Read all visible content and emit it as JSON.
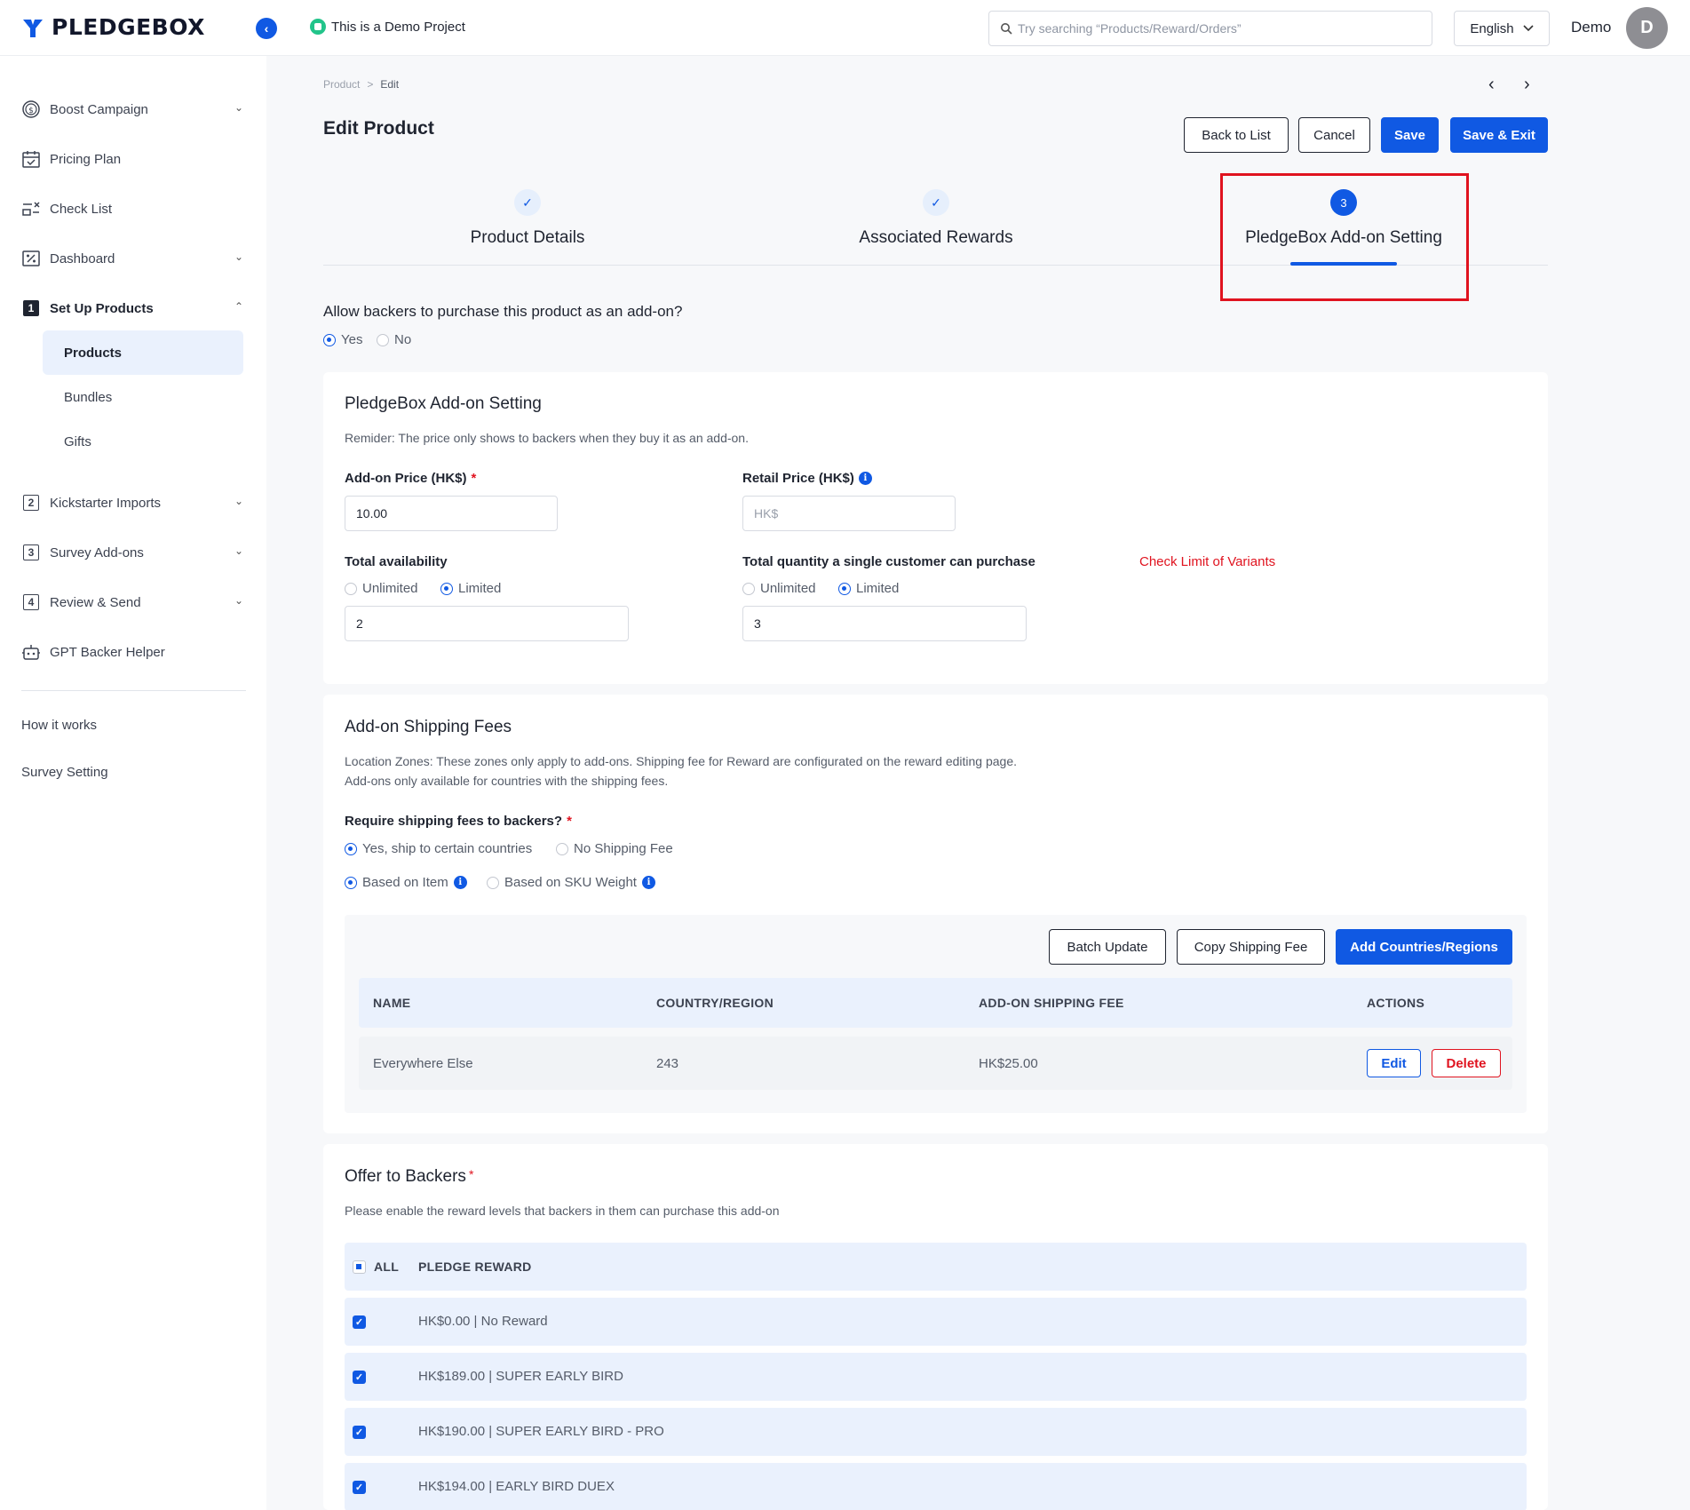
{
  "header": {
    "brand": "PLEDGEBOX",
    "demo_project": "This is a Demo Project",
    "search_placeholder": "Try searching “Products/Reward/Orders”",
    "language": "English",
    "user_name": "Demo",
    "avatar_initial": "D"
  },
  "sidebar": {
    "items": [
      {
        "label": "Boost Campaign",
        "icon": "dollar-circle-icon",
        "expandable": true
      },
      {
        "label": "Pricing Plan",
        "icon": "calendar-icon",
        "expandable": false
      },
      {
        "label": "Check List",
        "icon": "checklist-icon",
        "expandable": false
      },
      {
        "label": "Dashboard",
        "icon": "percent-icon",
        "expandable": true
      },
      {
        "label": "Set Up Products",
        "number": "1",
        "expandable": true,
        "expanded": true
      },
      {
        "label": "Kickstarter Imports",
        "number": "2",
        "expandable": true
      },
      {
        "label": "Survey Add-ons",
        "number": "3",
        "expandable": true
      },
      {
        "label": "Review & Send",
        "number": "4",
        "expandable": true
      },
      {
        "label": "GPT Backer Helper",
        "icon": "robot-icon",
        "expandable": false
      }
    ],
    "sub_items": [
      "Products",
      "Bundles",
      "Gifts"
    ],
    "active_sub_item": "Products",
    "footer_links": [
      "How it works",
      "Survey Setting"
    ]
  },
  "breadcrumb": {
    "root": "Product",
    "sep": ">",
    "current": "Edit"
  },
  "page": {
    "title": "Edit Product",
    "buttons": {
      "back": "Back to List",
      "cancel": "Cancel",
      "save": "Save",
      "save_exit": "Save & Exit"
    }
  },
  "steps": [
    {
      "label": "Product Details",
      "state": "done"
    },
    {
      "label": "Associated Rewards",
      "state": "done"
    },
    {
      "label": "PledgeBox Add-on Setting",
      "state": "current",
      "number": "3"
    }
  ],
  "addon_question": {
    "label": "Allow backers to purchase this product as an add-on?",
    "options": [
      "Yes",
      "No"
    ],
    "selected": "Yes"
  },
  "addon_setting": {
    "title": "PledgeBox Add-on Setting",
    "reminder": "Remider: The price only shows to backers when they buy it as an add-on.",
    "addon_price_label": "Add-on Price (HK$)",
    "addon_price_value": "10.00",
    "retail_price_label": "Retail Price (HK$)",
    "retail_price_placeholder": "HK$",
    "total_availability_label": "Total availability",
    "total_availability_options": [
      "Unlimited",
      "Limited"
    ],
    "total_availability_selected": "Limited",
    "total_availability_value": "2",
    "single_customer_label": "Total quantity a single customer can purchase",
    "single_customer_options": [
      "Unlimited",
      "Limited"
    ],
    "single_customer_selected": "Limited",
    "single_customer_value": "3",
    "check_limit_link": "Check Limit of Variants"
  },
  "shipping": {
    "title": "Add-on Shipping Fees",
    "note_line1": "Location Zones: These zones only apply to add-ons. Shipping fee for Reward are configurated on the reward editing page.",
    "note_line2": "Add-ons only available for countries with the shipping fees.",
    "require_label": "Require shipping fees to backers?",
    "require_options": [
      "Yes, ship to certain countries",
      "No Shipping Fee"
    ],
    "require_selected": "Yes, ship to certain countries",
    "basis_options": [
      "Based on Item",
      "Based on SKU Weight"
    ],
    "basis_selected": "Based on Item",
    "buttons": {
      "batch": "Batch Update",
      "copy": "Copy Shipping Fee",
      "add": "Add Countries/Regions"
    },
    "columns": [
      "NAME",
      "COUNTRY/REGION",
      "ADD-ON SHIPPING FEE",
      "ACTIONS"
    ],
    "rows": [
      {
        "name": "Everywhere Else",
        "country": "243",
        "fee": "HK$25.00",
        "edit": "Edit",
        "delete": "Delete"
      }
    ]
  },
  "offer": {
    "title": "Offer to Backers",
    "note": "Please enable the reward levels that backers in them can purchase this add-on",
    "header_all": "ALL",
    "header_reward": "PLEDGE REWARD",
    "rewards": [
      "HK$0.00 | No Reward",
      "HK$189.00 | SUPER EARLY BIRD",
      "HK$190.00 | SUPER EARLY BIRD - PRO",
      "HK$194.00 | EARLY BIRD DUEX"
    ]
  },
  "colors": {
    "primary": "#1059e3",
    "danger": "#e0131f",
    "highlight": "#e0131f"
  }
}
